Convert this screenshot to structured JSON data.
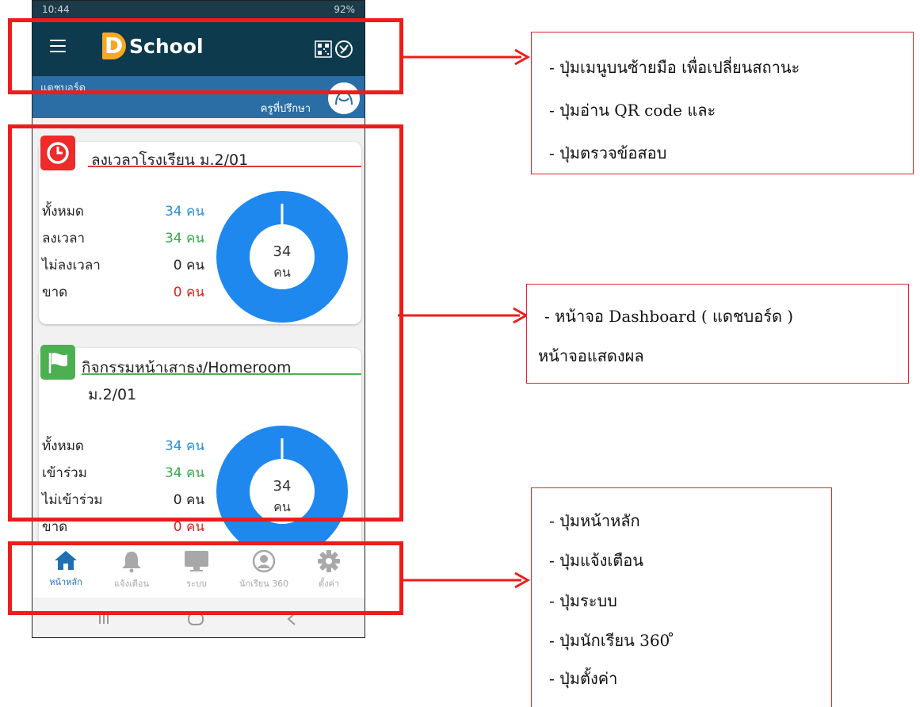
{
  "status_bar": {
    "time": "10:44",
    "right": "92%"
  },
  "app": {
    "logo_letter": "D",
    "logo_text": "School"
  },
  "banner": {
    "title": "แดชบอร์ด",
    "role": "ครูที่ปรึกษา"
  },
  "card1": {
    "title": "ลงเวลาโรงเรียน ม.2/01",
    "rows": [
      {
        "label": "ทั้งหมด",
        "value": "34 คน",
        "color": "#2b8fd6"
      },
      {
        "label": "ลงเวลา",
        "value": "34 คน",
        "color": "#36a84a"
      },
      {
        "label": "ไม่ลงเวลา",
        "value": "0 คน",
        "color": "#222222"
      },
      {
        "label": "ขาด",
        "value": "0 คน",
        "color": "#e02020"
      }
    ],
    "donut": {
      "number": "34",
      "unit": "คน",
      "fill_fraction": 1.0,
      "color": "#1e88ef"
    }
  },
  "card2": {
    "title": "กิจกรรมหน้าเสาธง/Homeroom",
    "subtitle": "ม.2/01",
    "rows": [
      {
        "label": "ทั้งหมด",
        "value": "34 คน",
        "color": "#2b8fd6"
      },
      {
        "label": "เข้าร่วม",
        "value": "34 คน",
        "color": "#36a84a"
      },
      {
        "label": "ไม่เข้าร่วม",
        "value": "0 คน",
        "color": "#222222"
      },
      {
        "label": "ขาด",
        "value": "0 คน",
        "color": "#e02020"
      }
    ],
    "donut": {
      "number": "34",
      "unit": "คน",
      "fill_fraction": 1.0,
      "color": "#1e88ef"
    }
  },
  "bottom_nav": [
    {
      "label": "หน้าหลัก",
      "icon": "home-icon",
      "active": true
    },
    {
      "label": "แจ้งเตือน",
      "icon": "bell-icon",
      "active": false
    },
    {
      "label": "ระบบ",
      "icon": "monitor-icon",
      "active": false
    },
    {
      "label": "นักเรียน 360",
      "icon": "student-icon",
      "active": false
    },
    {
      "label": "ตั้งค่า",
      "icon": "gear-icon",
      "active": false
    }
  ],
  "colors": {
    "appbar": "#0e3a4e",
    "banner": "#2a6ea5",
    "accent": "#f7a823",
    "annotation": "#ee1c1c",
    "nav_active": "#1f6fb5",
    "nav_inactive": "#a8a8a8"
  },
  "callouts": {
    "top": [
      "- ปุ่มเมนูบนซ้ายมือ เพื่อเปลี่ยนสถานะ",
      "- ปุ่มอ่าน QR code และ",
      "- ปุ่มตรวจข้อสอบ"
    ],
    "middle": [
      "- หน้าจอ Dashboard ( แดชบอร์ด )",
      "หน้าจอแสดงผล"
    ],
    "bottom": [
      "- ปุ่มหน้าหลัก",
      "- ปุ่มแจ้งเตือน",
      "- ปุ่มระบบ",
      "- ปุ่มนักเรียน 360 ̊",
      "- ปุ่มตั้งค่า"
    ]
  }
}
